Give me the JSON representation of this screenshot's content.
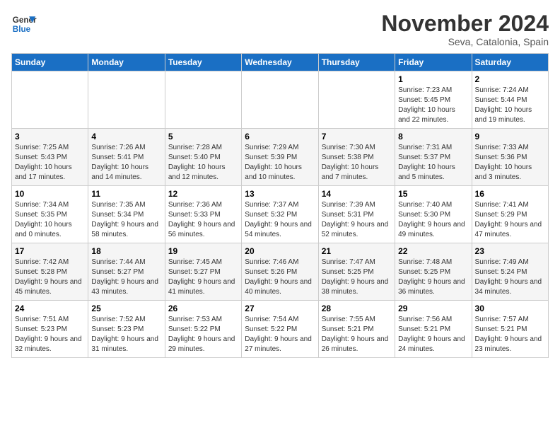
{
  "logo": {
    "line1": "General",
    "line2": "Blue"
  },
  "title": "November 2024",
  "location": "Seva, Catalonia, Spain",
  "weekdays": [
    "Sunday",
    "Monday",
    "Tuesday",
    "Wednesday",
    "Thursday",
    "Friday",
    "Saturday"
  ],
  "weeks": [
    [
      {
        "day": "",
        "info": ""
      },
      {
        "day": "",
        "info": ""
      },
      {
        "day": "",
        "info": ""
      },
      {
        "day": "",
        "info": ""
      },
      {
        "day": "",
        "info": ""
      },
      {
        "day": "1",
        "info": "Sunrise: 7:23 AM\nSunset: 5:45 PM\nDaylight: 10 hours and 22 minutes."
      },
      {
        "day": "2",
        "info": "Sunrise: 7:24 AM\nSunset: 5:44 PM\nDaylight: 10 hours and 19 minutes."
      }
    ],
    [
      {
        "day": "3",
        "info": "Sunrise: 7:25 AM\nSunset: 5:43 PM\nDaylight: 10 hours and 17 minutes."
      },
      {
        "day": "4",
        "info": "Sunrise: 7:26 AM\nSunset: 5:41 PM\nDaylight: 10 hours and 14 minutes."
      },
      {
        "day": "5",
        "info": "Sunrise: 7:28 AM\nSunset: 5:40 PM\nDaylight: 10 hours and 12 minutes."
      },
      {
        "day": "6",
        "info": "Sunrise: 7:29 AM\nSunset: 5:39 PM\nDaylight: 10 hours and 10 minutes."
      },
      {
        "day": "7",
        "info": "Sunrise: 7:30 AM\nSunset: 5:38 PM\nDaylight: 10 hours and 7 minutes."
      },
      {
        "day": "8",
        "info": "Sunrise: 7:31 AM\nSunset: 5:37 PM\nDaylight: 10 hours and 5 minutes."
      },
      {
        "day": "9",
        "info": "Sunrise: 7:33 AM\nSunset: 5:36 PM\nDaylight: 10 hours and 3 minutes."
      }
    ],
    [
      {
        "day": "10",
        "info": "Sunrise: 7:34 AM\nSunset: 5:35 PM\nDaylight: 10 hours and 0 minutes."
      },
      {
        "day": "11",
        "info": "Sunrise: 7:35 AM\nSunset: 5:34 PM\nDaylight: 9 hours and 58 minutes."
      },
      {
        "day": "12",
        "info": "Sunrise: 7:36 AM\nSunset: 5:33 PM\nDaylight: 9 hours and 56 minutes."
      },
      {
        "day": "13",
        "info": "Sunrise: 7:37 AM\nSunset: 5:32 PM\nDaylight: 9 hours and 54 minutes."
      },
      {
        "day": "14",
        "info": "Sunrise: 7:39 AM\nSunset: 5:31 PM\nDaylight: 9 hours and 52 minutes."
      },
      {
        "day": "15",
        "info": "Sunrise: 7:40 AM\nSunset: 5:30 PM\nDaylight: 9 hours and 49 minutes."
      },
      {
        "day": "16",
        "info": "Sunrise: 7:41 AM\nSunset: 5:29 PM\nDaylight: 9 hours and 47 minutes."
      }
    ],
    [
      {
        "day": "17",
        "info": "Sunrise: 7:42 AM\nSunset: 5:28 PM\nDaylight: 9 hours and 45 minutes."
      },
      {
        "day": "18",
        "info": "Sunrise: 7:44 AM\nSunset: 5:27 PM\nDaylight: 9 hours and 43 minutes."
      },
      {
        "day": "19",
        "info": "Sunrise: 7:45 AM\nSunset: 5:27 PM\nDaylight: 9 hours and 41 minutes."
      },
      {
        "day": "20",
        "info": "Sunrise: 7:46 AM\nSunset: 5:26 PM\nDaylight: 9 hours and 40 minutes."
      },
      {
        "day": "21",
        "info": "Sunrise: 7:47 AM\nSunset: 5:25 PM\nDaylight: 9 hours and 38 minutes."
      },
      {
        "day": "22",
        "info": "Sunrise: 7:48 AM\nSunset: 5:25 PM\nDaylight: 9 hours and 36 minutes."
      },
      {
        "day": "23",
        "info": "Sunrise: 7:49 AM\nSunset: 5:24 PM\nDaylight: 9 hours and 34 minutes."
      }
    ],
    [
      {
        "day": "24",
        "info": "Sunrise: 7:51 AM\nSunset: 5:23 PM\nDaylight: 9 hours and 32 minutes."
      },
      {
        "day": "25",
        "info": "Sunrise: 7:52 AM\nSunset: 5:23 PM\nDaylight: 9 hours and 31 minutes."
      },
      {
        "day": "26",
        "info": "Sunrise: 7:53 AM\nSunset: 5:22 PM\nDaylight: 9 hours and 29 minutes."
      },
      {
        "day": "27",
        "info": "Sunrise: 7:54 AM\nSunset: 5:22 PM\nDaylight: 9 hours and 27 minutes."
      },
      {
        "day": "28",
        "info": "Sunrise: 7:55 AM\nSunset: 5:21 PM\nDaylight: 9 hours and 26 minutes."
      },
      {
        "day": "29",
        "info": "Sunrise: 7:56 AM\nSunset: 5:21 PM\nDaylight: 9 hours and 24 minutes."
      },
      {
        "day": "30",
        "info": "Sunrise: 7:57 AM\nSunset: 5:21 PM\nDaylight: 9 hours and 23 minutes."
      }
    ]
  ]
}
